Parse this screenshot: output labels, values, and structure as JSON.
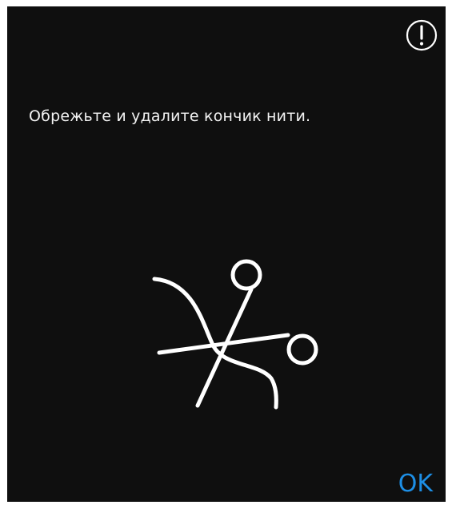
{
  "dialog": {
    "message": "Обрежьте и удалите кончик нити.",
    "ok_label": "OK",
    "alert_icon": "alert-exclamation-icon",
    "illustration_icon": "scissors-thread-icon"
  },
  "colors": {
    "background": "#0f0f0f",
    "text": "#f2f2f2",
    "icon": "#ffffff",
    "accent": "#1d8fe6"
  }
}
